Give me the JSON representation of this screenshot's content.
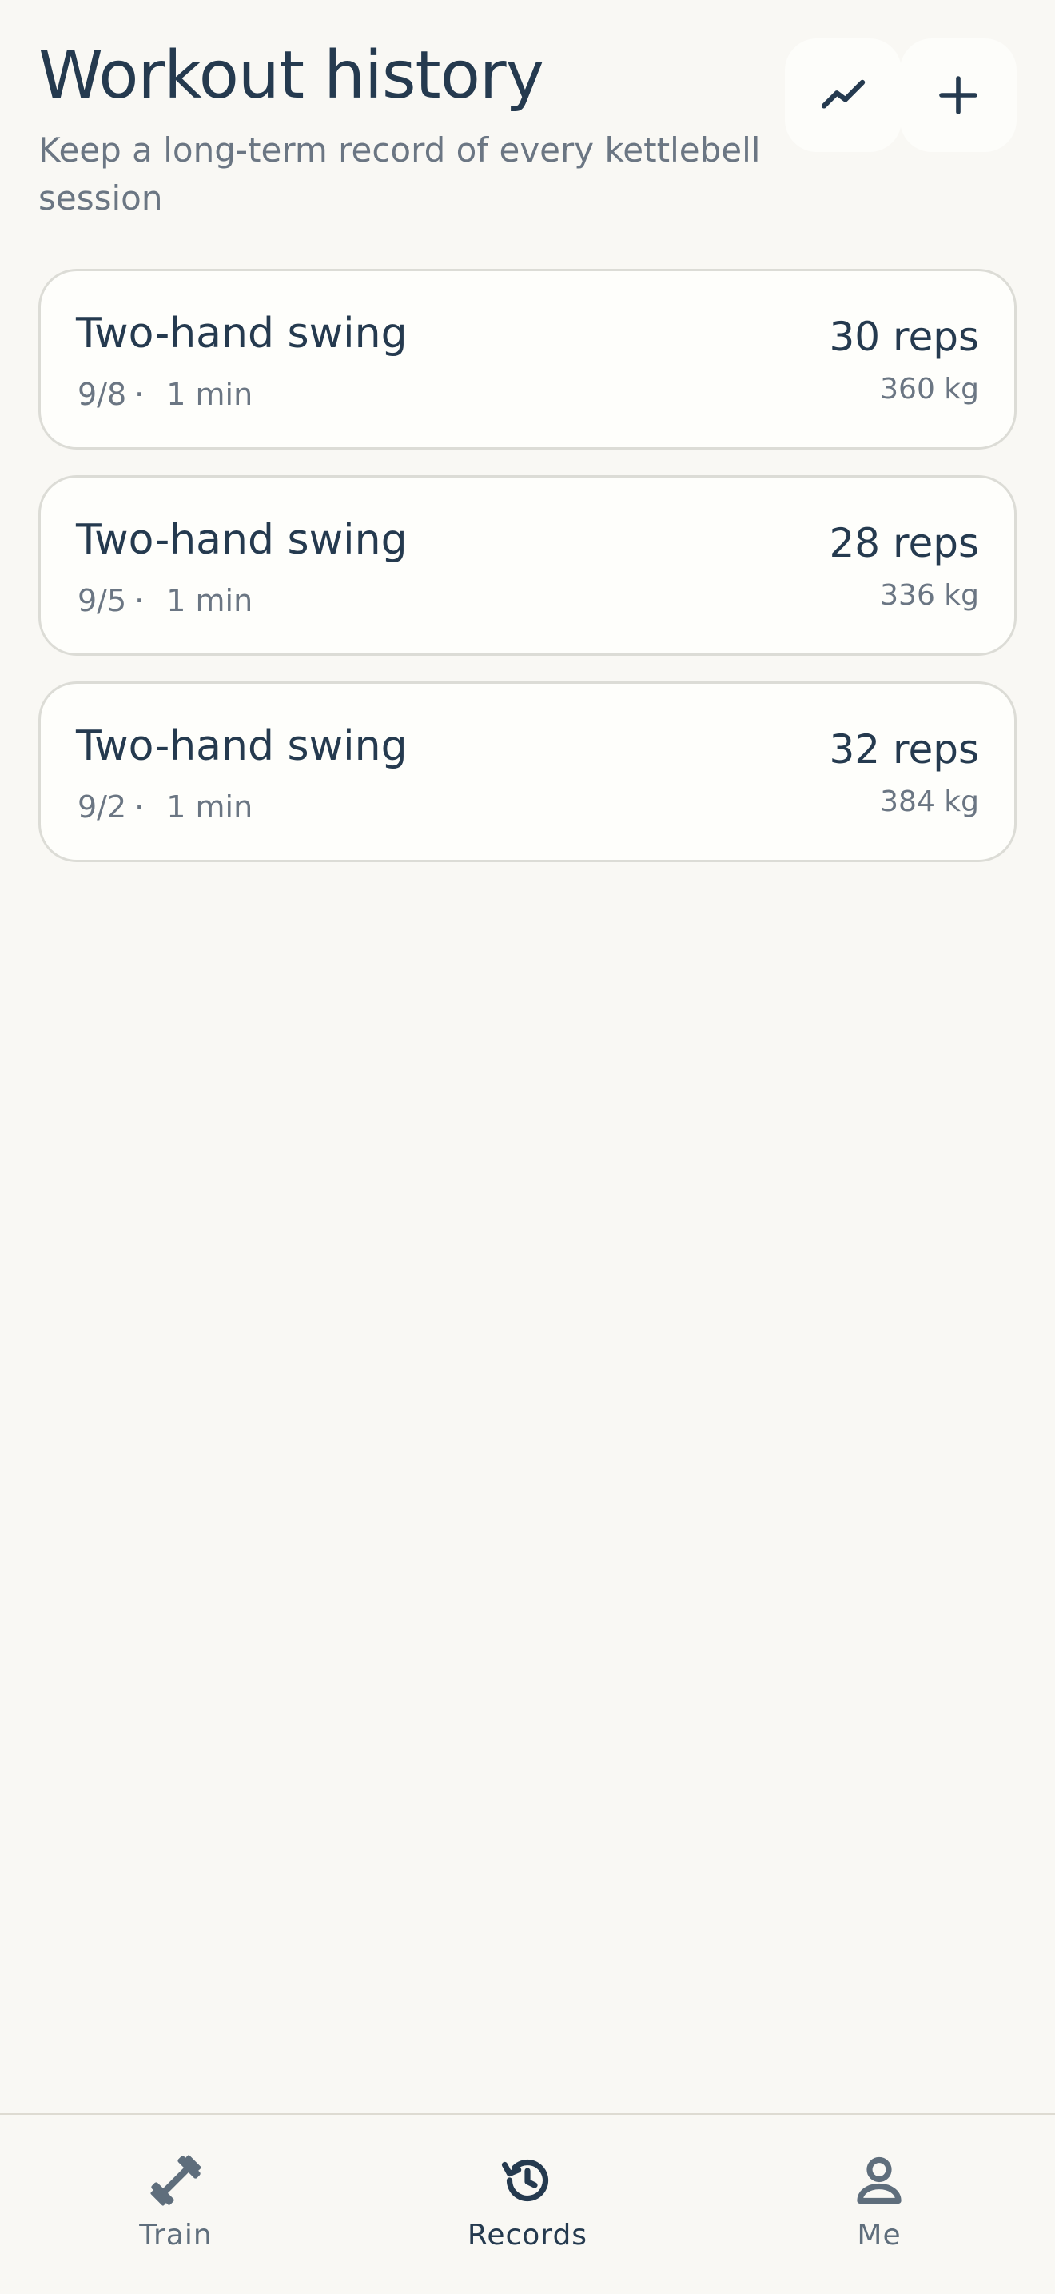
{
  "header": {
    "title": "Workout history",
    "subtitle": "Keep a long-term record of every kettlebell session"
  },
  "actions": {
    "chart_icon": "trending-up-icon",
    "add_icon": "plus-icon"
  },
  "records": [
    {
      "exercise": "Two-hand swing",
      "date": "9/8",
      "separator": "·",
      "duration": "1 min",
      "reps": "30 reps",
      "weight": "360 kg"
    },
    {
      "exercise": "Two-hand swing",
      "date": "9/5",
      "separator": "·",
      "duration": "1 min",
      "reps": "28 reps",
      "weight": "336 kg"
    },
    {
      "exercise": "Two-hand swing",
      "date": "9/2",
      "separator": "·",
      "duration": "1 min",
      "reps": "32 reps",
      "weight": "384 kg"
    }
  ],
  "nav": {
    "items": [
      {
        "label": "Train",
        "icon": "dumbbell-icon",
        "active": false
      },
      {
        "label": "Records",
        "icon": "history-icon",
        "active": true
      },
      {
        "label": "Me",
        "icon": "person-icon",
        "active": false
      }
    ]
  },
  "colors": {
    "background": "#f9f8f4",
    "text_primary": "#253a4f",
    "text_secondary": "#6b7683",
    "card_border": "#dcdcd6"
  }
}
